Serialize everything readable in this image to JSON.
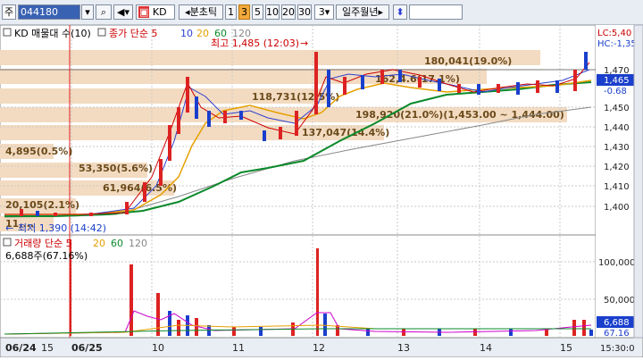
{
  "toolbar": {
    "mode": "주",
    "code": "044180",
    "name": "KD",
    "period_label": "분초틱",
    "period_options": [
      "1",
      "3",
      "5",
      "10",
      "20",
      "30"
    ],
    "selected_period": "3",
    "unit_value": "3",
    "unit_options": "일주월년"
  },
  "price_panel": {
    "title": "KD 매물대 수(10)",
    "ma_label": "종가 단순 5",
    "ma_periods": [
      "10",
      "20",
      "60",
      "120"
    ],
    "ma_colors": [
      "#cc0000",
      "#2b3fd0",
      "#e6a000",
      "#0a8a2a",
      "#888888"
    ],
    "high_label": "최고 1,485 (12:03)",
    "low_label": "최저 1,390 (14:42)",
    "lc_label": "LC:5,40",
    "hc_label": "HC:-1,35",
    "current_price": "1,465",
    "pct_change": "-0.68",
    "y_ticks": [
      "1,470",
      "1,460",
      "1,450",
      "1,440",
      "1,430",
      "1,420",
      "1,410",
      "1,400"
    ],
    "volume_profile": [
      {
        "label": "180,041(19.0%)"
      },
      {
        "label": "162,4.6(17.1%)"
      },
      {
        "label": "118,731(12.5%)"
      },
      {
        "label": "198,920(21.0%)(1,453.00 ~ 1,444.00)"
      },
      {
        "label": "137,047(14.4%)"
      },
      {
        "label": "4,895(0.5%)"
      },
      {
        "label": "53,350(5.6%)"
      },
      {
        "label": "61,964(6.5%)"
      },
      {
        "label": "20,105(2.1%)"
      },
      {
        "label": "11,..."
      }
    ]
  },
  "volume_panel": {
    "title": "거래량 단순 5",
    "ma_periods": [
      "20",
      "60",
      "120"
    ],
    "current_label": "6,688주(67.16%)",
    "current_value": "6,688",
    "pct": "67.16",
    "y_ticks": [
      "100,000",
      "50,000"
    ]
  },
  "x_axis": {
    "labels": [
      "06/24",
      "15",
      "06/25",
      "10",
      "11",
      "12",
      "13",
      "14",
      "15"
    ],
    "time_label": "15:30:0"
  }
}
